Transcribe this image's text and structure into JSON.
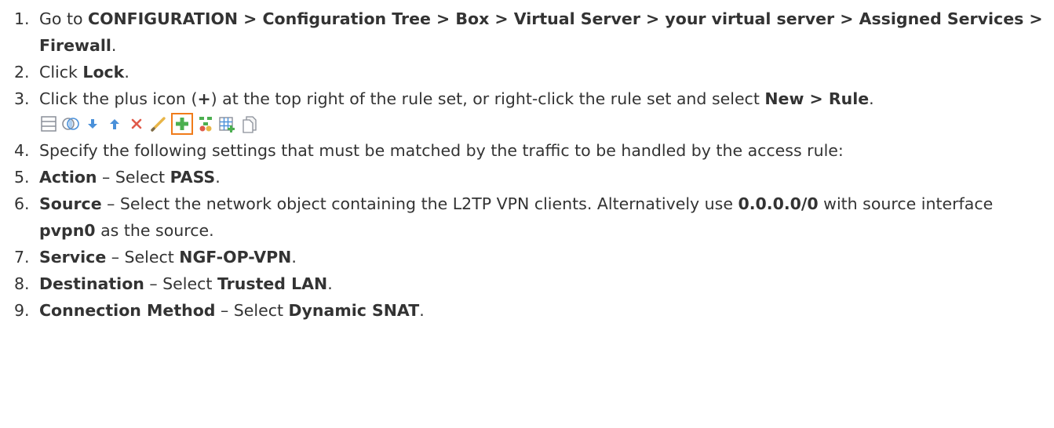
{
  "steps": [
    {
      "num": "1.",
      "parts": [
        {
          "t": "Go to "
        },
        {
          "t": "CONFIGURATION > Configuration Tree > Box > Virtual Server > your virtual server > Assigned Services > Firewall",
          "b": true
        },
        {
          "t": "."
        }
      ]
    },
    {
      "num": "2.",
      "parts": [
        {
          "t": "Click "
        },
        {
          "t": "Lock",
          "b": true
        },
        {
          "t": "."
        }
      ]
    },
    {
      "num": "3.",
      "parts": [
        {
          "t": "Click the plus icon ("
        },
        {
          "t": "+",
          "b": true
        },
        {
          "t": ") at the top right of the rule set, or right-click the rule set and select "
        },
        {
          "t": "New > Rule",
          "b": true
        },
        {
          "t": "."
        }
      ],
      "toolbar": [
        "list-view-icon",
        "merge-icon",
        "move-down-icon",
        "move-up-icon",
        "delete-icon",
        "edit-icon",
        "add-rule-icon",
        "rule-settings-icon",
        "add-grid-icon",
        "copy-icon"
      ]
    },
    {
      "num": "4.",
      "parts": [
        {
          "t": "Specify the following settings that must be matched by the traffic to be handled by the access rule:"
        }
      ]
    },
    {
      "num": "5.",
      "parts": [
        {
          "t": "Action",
          "b": true
        },
        {
          "t": " – Select "
        },
        {
          "t": "PASS",
          "b": true
        },
        {
          "t": "."
        }
      ]
    },
    {
      "num": "6.",
      "parts": [
        {
          "t": "Source",
          "b": true
        },
        {
          "t": " – Select the network object containing the L2TP VPN clients. Alternatively use "
        },
        {
          "t": "0.0.0.0/0",
          "b": true
        },
        {
          "t": " with source interface "
        },
        {
          "t": "pvpn0",
          "b": true
        },
        {
          "t": " as the source."
        }
      ]
    },
    {
      "num": "7.",
      "parts": [
        {
          "t": "Service",
          "b": true
        },
        {
          "t": " – Select "
        },
        {
          "t": "NGF-OP-VPN",
          "b": true
        },
        {
          "t": "."
        }
      ]
    },
    {
      "num": "8.",
      "parts": [
        {
          "t": "Destination",
          "b": true
        },
        {
          "t": " – Select "
        },
        {
          "t": "Trusted LAN",
          "b": true
        },
        {
          "t": "."
        }
      ]
    },
    {
      "num": "9.",
      "parts": [
        {
          "t": "Connection Method",
          "b": true
        },
        {
          "t": " – Select "
        },
        {
          "t": "Dynamic SNAT",
          "b": true
        },
        {
          "t": "."
        }
      ]
    }
  ],
  "colors": {
    "text": "#333333",
    "highlight": "#f07b1a",
    "icon_gray": "#8a8f99",
    "icon_blue": "#4a90d9",
    "icon_red": "#e05a4a",
    "icon_green": "#4caf50"
  }
}
